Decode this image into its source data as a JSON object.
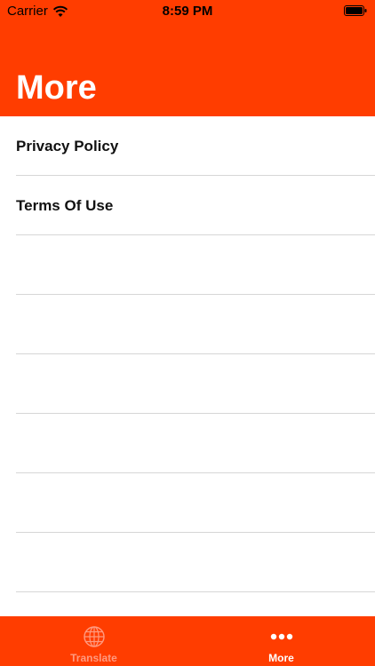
{
  "status_bar": {
    "carrier": "Carrier",
    "time": "8:59 PM"
  },
  "header": {
    "title": "More",
    "color": "#ff3d00"
  },
  "list": {
    "items": [
      {
        "label": "Privacy Policy"
      },
      {
        "label": "Terms Of Use"
      }
    ]
  },
  "tab_bar": {
    "tabs": [
      {
        "label": "Translate",
        "icon": "globe-icon",
        "active": false
      },
      {
        "label": "More",
        "icon": "more-dots-icon",
        "active": true
      }
    ]
  }
}
